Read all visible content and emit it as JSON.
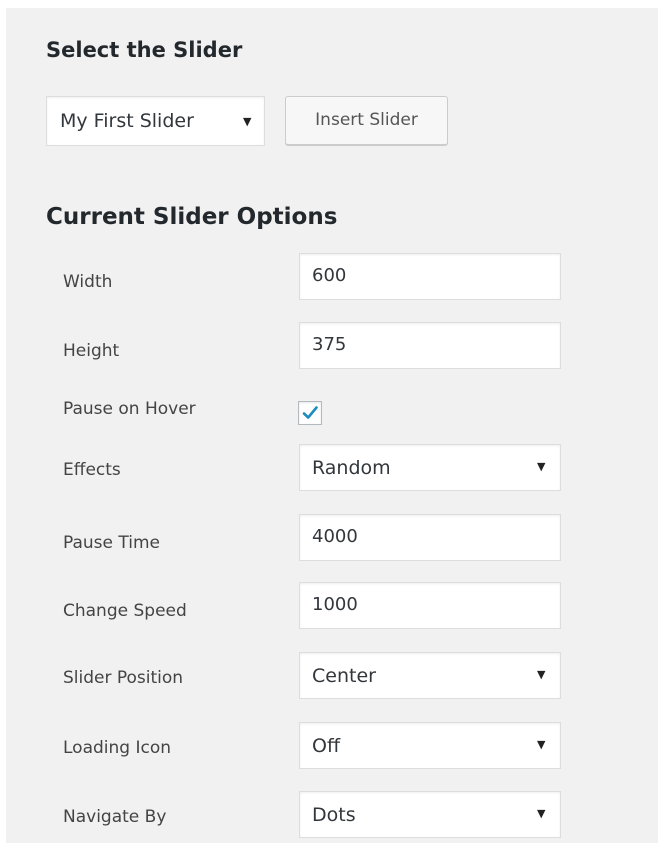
{
  "select_section": {
    "title": "Select the Slider",
    "slider_select_value": "My First Slider",
    "insert_button_label": "Insert Slider"
  },
  "options_section": {
    "title": "Current Slider Options",
    "width": {
      "label": "Width",
      "value": "600"
    },
    "height": {
      "label": "Height",
      "value": "375"
    },
    "pause_on_hover": {
      "label": "Pause on Hover",
      "checked": true
    },
    "effects": {
      "label": "Effects",
      "value": "Random"
    },
    "pause_time": {
      "label": "Pause Time",
      "value": "4000"
    },
    "change_speed": {
      "label": "Change Speed",
      "value": "1000"
    },
    "slider_position": {
      "label": "Slider Position",
      "value": "Center"
    },
    "loading_icon": {
      "label": "Loading Icon",
      "value": "Off"
    },
    "navigate_by": {
      "label": "Navigate By",
      "value": "Dots"
    }
  },
  "icons": {
    "dropdown": "caret-down-icon",
    "checkbox_check": "checkmark-icon"
  },
  "colors": {
    "panel_background": "#f1f1f1",
    "checkmark": "#1e8cbe",
    "heading": "#23282d"
  }
}
